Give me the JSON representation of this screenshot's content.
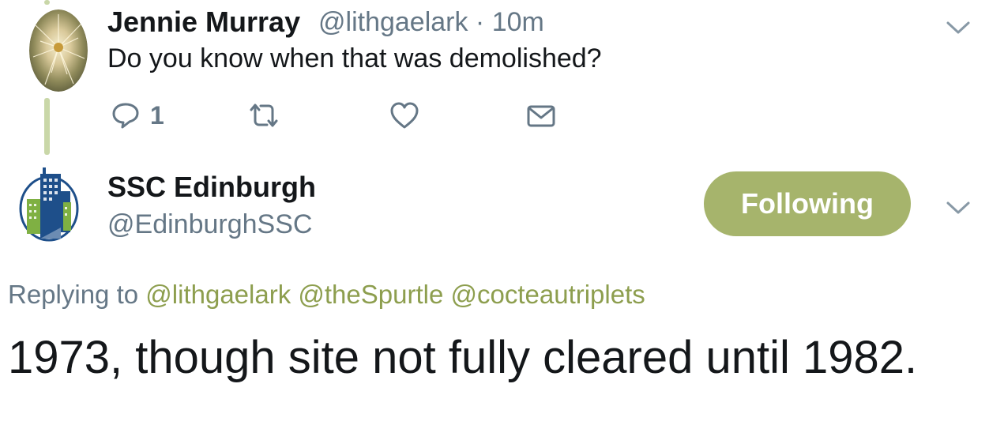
{
  "first_tweet": {
    "author_name": "Jennie Murray",
    "author_handle_time": "@lithgaelark · 10m",
    "text": "Do you know when that was demolished?",
    "reply_count": "1",
    "avatar_icon": "dandelion-photo-icon"
  },
  "reply_tweet": {
    "author_name": "SSC Edinburgh",
    "author_handle": "@EdinburghSSC",
    "follow_button_label": "Following",
    "replying_prefix": "Replying to",
    "mentions": [
      "@lithgaelark",
      "@theSpurtle",
      "@cocteautriplets"
    ],
    "text": "1973, though site not fully cleared until 1982.",
    "avatar_icon": "building-logo-icon"
  },
  "colors": {
    "accent_green": "#a6b46c",
    "mention_green": "#8d9e4e",
    "thread_line": "#c9d7a8",
    "secondary_text": "#657786",
    "primary_text": "#14171a"
  }
}
